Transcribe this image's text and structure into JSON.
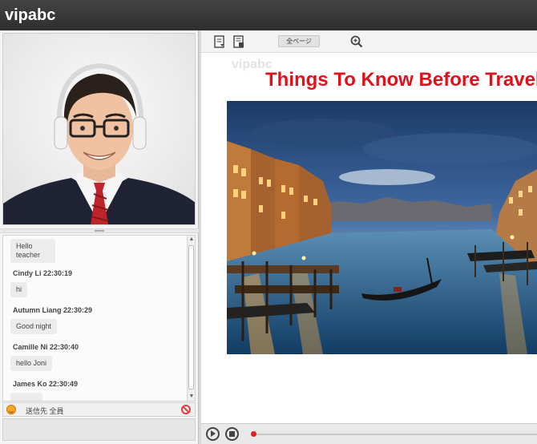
{
  "app": {
    "logo": "vipabc"
  },
  "video": {
    "person": "teacher-video"
  },
  "chat": {
    "messages": [
      {
        "text": "Hello teacher"
      },
      {
        "sender": "Cindy Li 22:30:19",
        "text": "hi"
      },
      {
        "sender": "Autumn Liang 22:30:29",
        "text": "Good night"
      },
      {
        "sender": "Camille Ni 22:30:40",
        "text": "hello Joni"
      },
      {
        "sender": "James Ko 22:30:49",
        "text": ""
      }
    ],
    "send_to_label": "送信先 全員"
  },
  "toolbar": {
    "page_select": "全ページ",
    "icons": [
      "document-download-icon",
      "document-list-icon",
      "zoom-icon"
    ]
  },
  "slide": {
    "watermark": "vipabc",
    "title": "Things To Know Before Travel"
  },
  "playbar": {
    "icons": [
      "play-icon",
      "stop-icon"
    ]
  },
  "colors": {
    "title_red": "#e2101a",
    "progress_red": "#e02020",
    "topbar": "#3a3a3a"
  }
}
